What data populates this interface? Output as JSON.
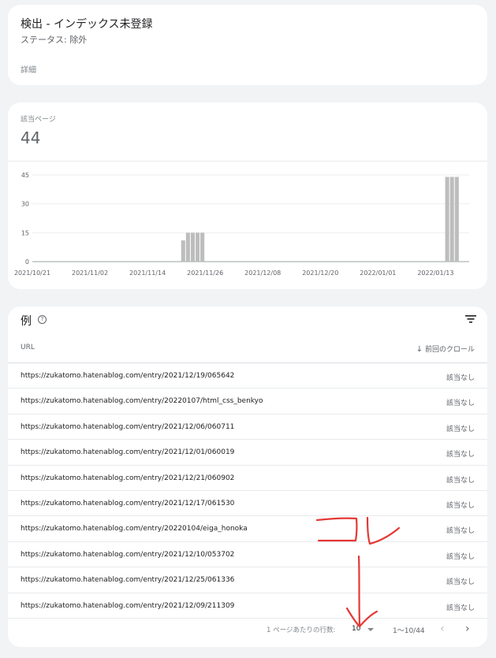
{
  "status_card": {
    "title": "検出 - インデックス未登録",
    "status": "ステータス: 除外",
    "details": "詳細"
  },
  "summary": {
    "label": "該当ページ",
    "value": "44"
  },
  "chart_data": {
    "type": "bar",
    "x_tick_labels": [
      "2021/10/21",
      "2021/11/02",
      "2021/11/14",
      "2021/11/26",
      "2021/12/08",
      "2021/12/20",
      "2022/01/01",
      "2022/01/13"
    ],
    "y_ticks": [
      0,
      15,
      30,
      45
    ],
    "ylim": [
      0,
      45
    ],
    "x_start": "2021/10/21",
    "x_end": "2022/01/20",
    "bars": [
      {
        "date": "2021/11/21",
        "value": 11
      },
      {
        "date": "2021/11/22",
        "value": 15
      },
      {
        "date": "2021/11/23",
        "value": 15
      },
      {
        "date": "2021/11/24",
        "value": 15
      },
      {
        "date": "2021/11/25",
        "value": 15
      },
      {
        "date": "2022/01/15",
        "value": 44
      },
      {
        "date": "2022/01/16",
        "value": 44
      },
      {
        "date": "2022/01/17",
        "value": 44
      }
    ],
    "bar_color": "#bdbdbd",
    "grid": true
  },
  "examples": {
    "title": "例",
    "col_url": "URL",
    "col_crawl": "前回のクロール",
    "rows": [
      {
        "url": "https://zukatomo.hatenablog.com/entry/2021/12/19/065642",
        "crawl": "該当なし"
      },
      {
        "url": "https://zukatomo.hatenablog.com/entry/20220107/html_css_benkyo",
        "crawl": "該当なし"
      },
      {
        "url": "https://zukatomo.hatenablog.com/entry/2021/12/06/060711",
        "crawl": "該当なし"
      },
      {
        "url": "https://zukatomo.hatenablog.com/entry/2021/12/01/060019",
        "crawl": "該当なし"
      },
      {
        "url": "https://zukatomo.hatenablog.com/entry/2021/12/21/060902",
        "crawl": "該当なし"
      },
      {
        "url": "https://zukatomo.hatenablog.com/entry/2021/12/17/061530",
        "crawl": "該当なし"
      },
      {
        "url": "https://zukatomo.hatenablog.com/entry/20220104/eiga_honoka",
        "crawl": "該当なし"
      },
      {
        "url": "https://zukatomo.hatenablog.com/entry/2021/12/10/053702",
        "crawl": "該当なし"
      },
      {
        "url": "https://zukatomo.hatenablog.com/entry/2021/12/25/061336",
        "crawl": "該当なし"
      },
      {
        "url": "https://zukatomo.hatenablog.com/entry/2021/12/09/211309",
        "crawl": "該当なし"
      }
    ]
  },
  "pagination": {
    "rows_label": "1 ページあたりの行数:",
    "rows_per_page": "10",
    "range": "1～10/44"
  },
  "annotation": {
    "color": "#e53935"
  }
}
